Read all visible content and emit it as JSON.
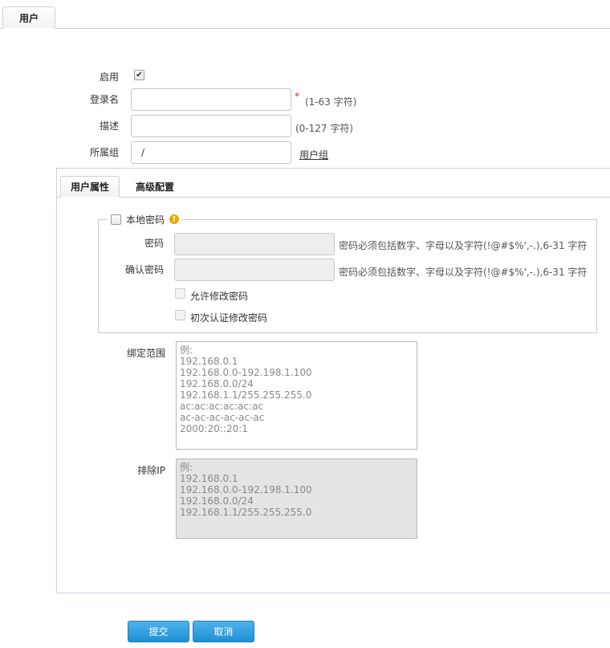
{
  "top_tab": {
    "label": "用户"
  },
  "form": {
    "enable": {
      "label": "启用",
      "checked": true
    },
    "login_name": {
      "label": "登录名",
      "value": "",
      "required_mark": "*",
      "hint": "(1-63 字符)"
    },
    "description": {
      "label": "描述",
      "value": "",
      "hint": "(0-127 字符)"
    },
    "group": {
      "label": "所属组",
      "value": "/",
      "link": "用户组"
    }
  },
  "inner_tabs": {
    "user_props": "用户属性",
    "advanced": "高级配置"
  },
  "local_password": {
    "legend": "本地密码",
    "warn_glyph": "!",
    "password": {
      "label": "密码",
      "hint": "密码必须包括数字、字母以及字符(!@#$%',-.),6-31 字符"
    },
    "confirm": {
      "label": "确认密码",
      "hint": "密码必须包括数字、字母以及字符(!@#$%',-.),6-31 字符"
    },
    "allow_change": "允许修改密码",
    "first_auth_change": "初次认证修改密码"
  },
  "bind_range": {
    "label": "绑定范围",
    "placeholder": "例:\n192.168.0.1\n192.168.0.0-192.198.1.100\n192.168.0.0/24\n192.168.1.1/255.255.255.0\nac:ac:ac:ac:ac:ac\nac-ac-ac-ac-ac-ac\n2000:20::20:1"
  },
  "exclude_ip": {
    "label": "排除IP",
    "placeholder": "例:\n192.168.0.1\n192.168.0.0-192.198.1.100\n192.168.0.0/24\n192.168.1.1/255.255.255.0"
  },
  "buttons": {
    "submit": "提交",
    "cancel": "取消"
  },
  "icons": {
    "checkmark": "✔",
    "warning": "warning-icon"
  },
  "colors": {
    "accent": "#1e8fd4",
    "required": "#e02020",
    "warning": "#f0a800"
  }
}
